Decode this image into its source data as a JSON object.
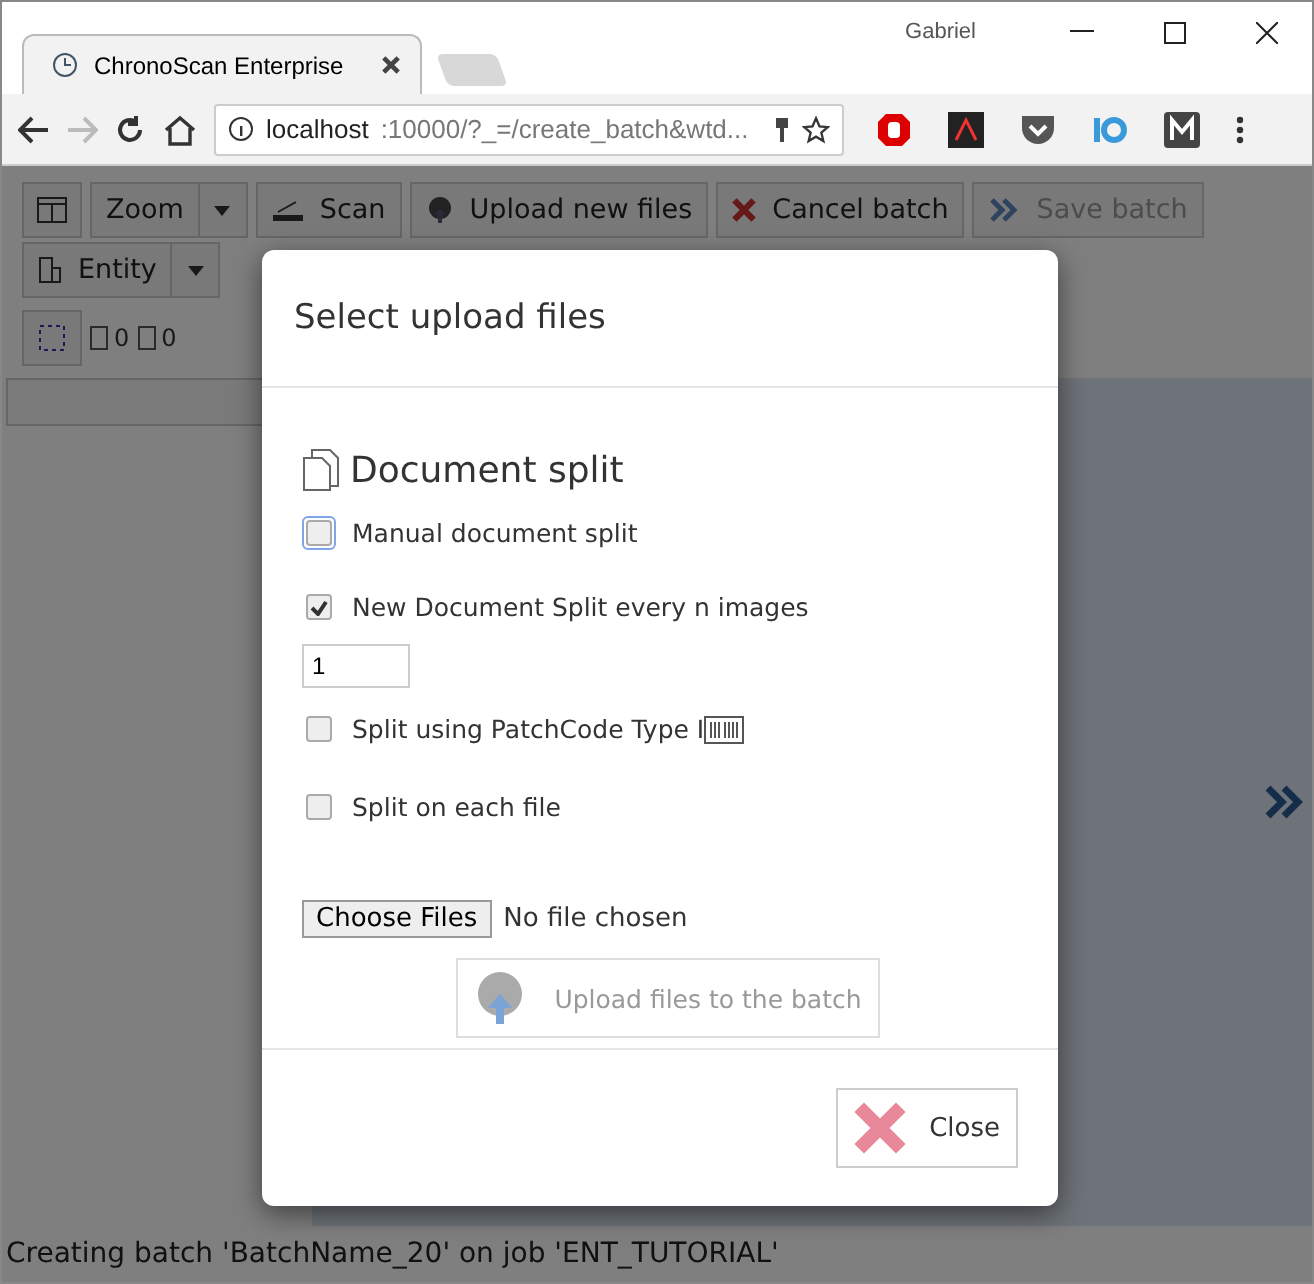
{
  "browser": {
    "user": "Gabriel",
    "tab_title": "ChronoScan Enterprise",
    "url_host": "localhost",
    "url_rest": ":10000/?_=/create_batch&wtd..."
  },
  "toolbar": [
    {
      "kind": "icon"
    },
    {
      "kind": "split",
      "label": "Zoom",
      "disabled": false
    },
    {
      "kind": "scan",
      "label": "Scan",
      "disabled": false
    },
    {
      "kind": "upload",
      "label": "Upload new files",
      "disabled": false
    },
    {
      "kind": "cancel",
      "label": "Cancel batch",
      "disabled": false
    },
    {
      "kind": "save",
      "label": "Save batch",
      "disabled": true
    },
    {
      "kind": "entity",
      "label": "Entity",
      "disabled": false
    }
  ],
  "counts": [
    "0",
    "0"
  ],
  "dialog": {
    "title": "Select upload files",
    "section_title": "Document split",
    "options": [
      {
        "label": "Manual document split",
        "checked": false,
        "focused": true
      },
      {
        "label": "New Document Split every n images",
        "checked": true,
        "focused": false,
        "value": "1"
      },
      {
        "label": "Split using PatchCode Type I",
        "checked": false,
        "focused": false,
        "barcode": true
      },
      {
        "label": "Split on each file",
        "checked": false,
        "focused": false
      }
    ],
    "file_button": "Choose Files",
    "file_status": "No file chosen",
    "upload_button": {
      "label": "Upload files to the batch",
      "disabled": true
    },
    "close_button": "Close"
  },
  "status_bar": "Creating batch 'BatchName_20' on job 'ENT_TUTORIAL'"
}
